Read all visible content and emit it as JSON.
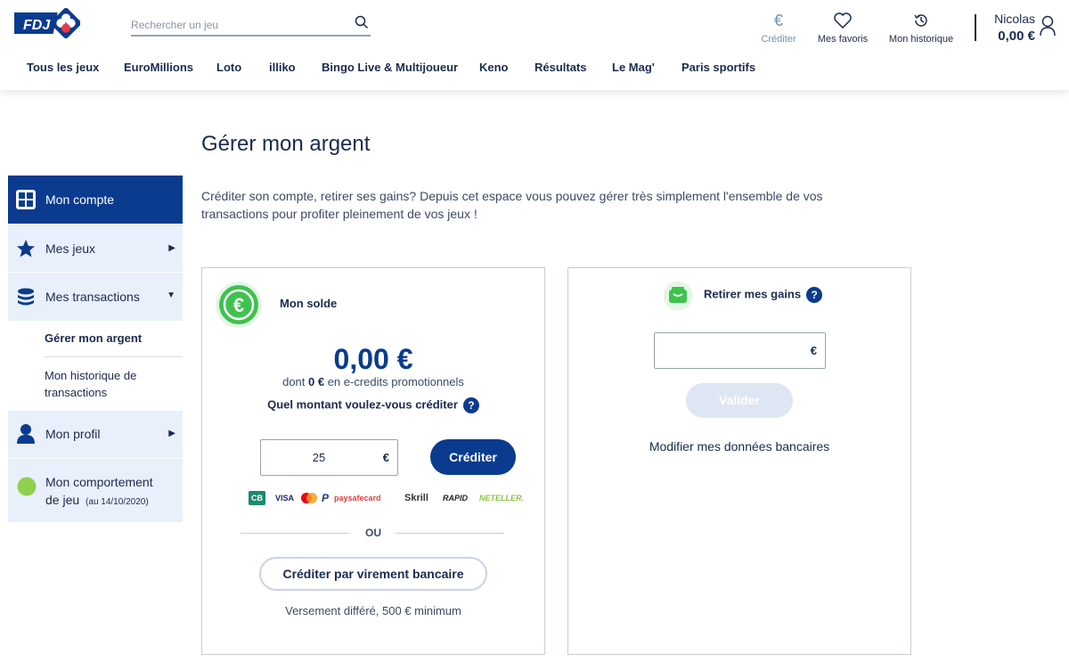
{
  "header": {
    "logo_text": "FDJ",
    "search_placeholder": "Rechercher un jeu",
    "actions": {
      "crediter": "Créditer",
      "favoris": "Mes favoris",
      "historique": "Mon historique"
    },
    "user": {
      "name": "Nicolas",
      "balance": "0,00 €"
    },
    "nav": [
      "Tous les jeux",
      "EuroMillions",
      "Loto",
      "illiko",
      "Bingo Live & Multijoueur",
      "Keno",
      "Résultats",
      "Le Mag'",
      "Paris sportifs"
    ]
  },
  "sidebar": {
    "items": [
      {
        "label": "Mon compte",
        "icon": "dashboard-icon",
        "active": true
      },
      {
        "label": "Mes jeux",
        "icon": "star-icon",
        "arrow": "▶"
      },
      {
        "label": "Mes transactions",
        "icon": "coins-icon",
        "arrow": "▼"
      },
      {
        "label": "Mon profil",
        "icon": "user-icon",
        "arrow": "▶"
      },
      {
        "label": "Mon comportement",
        "label2": "de jeu",
        "date": "(au 14/10/2020)",
        "icon": "status-dot-icon"
      }
    ],
    "sub_items": [
      "Gérer mon argent",
      "Mon historique de",
      "transactions"
    ]
  },
  "main": {
    "title": "Gérer mon argent",
    "intro": "Créditer son compte, retirer ses gains? Depuis cet espace vous pouvez gérer très simplement l'ensemble de vos transactions pour profiter pleinement de vos jeux !",
    "balance_card": {
      "title": "Mon solde",
      "amount": "0,00 €",
      "sub_prefix": "dont ",
      "sub_amount": "0 €",
      "sub_suffix": " en e-credits promotionnels",
      "question": "Quel montant voulez-vous créditer",
      "input_value": "25",
      "currency": "€",
      "credit_button": "Créditer",
      "payment_methods": [
        "CB",
        "VISA",
        "MC",
        "P",
        "paysafecard",
        "Skrill",
        "RAPID",
        "NETELLER."
      ],
      "or": "OU",
      "transfer_button": "Créditer par virement bancaire",
      "transfer_note": "Versement différé, 500 € minimum"
    },
    "withdraw_card": {
      "title": "Retirer mes gains",
      "currency": "€",
      "validate_button": "Valider",
      "bank_link": "Modifier mes données bancaires"
    }
  },
  "colors": {
    "brand_blue": "#0a3b8f",
    "sidebar_bg": "#e9f0fb",
    "green": "#3ec24e",
    "status_green": "#8fd14f"
  }
}
